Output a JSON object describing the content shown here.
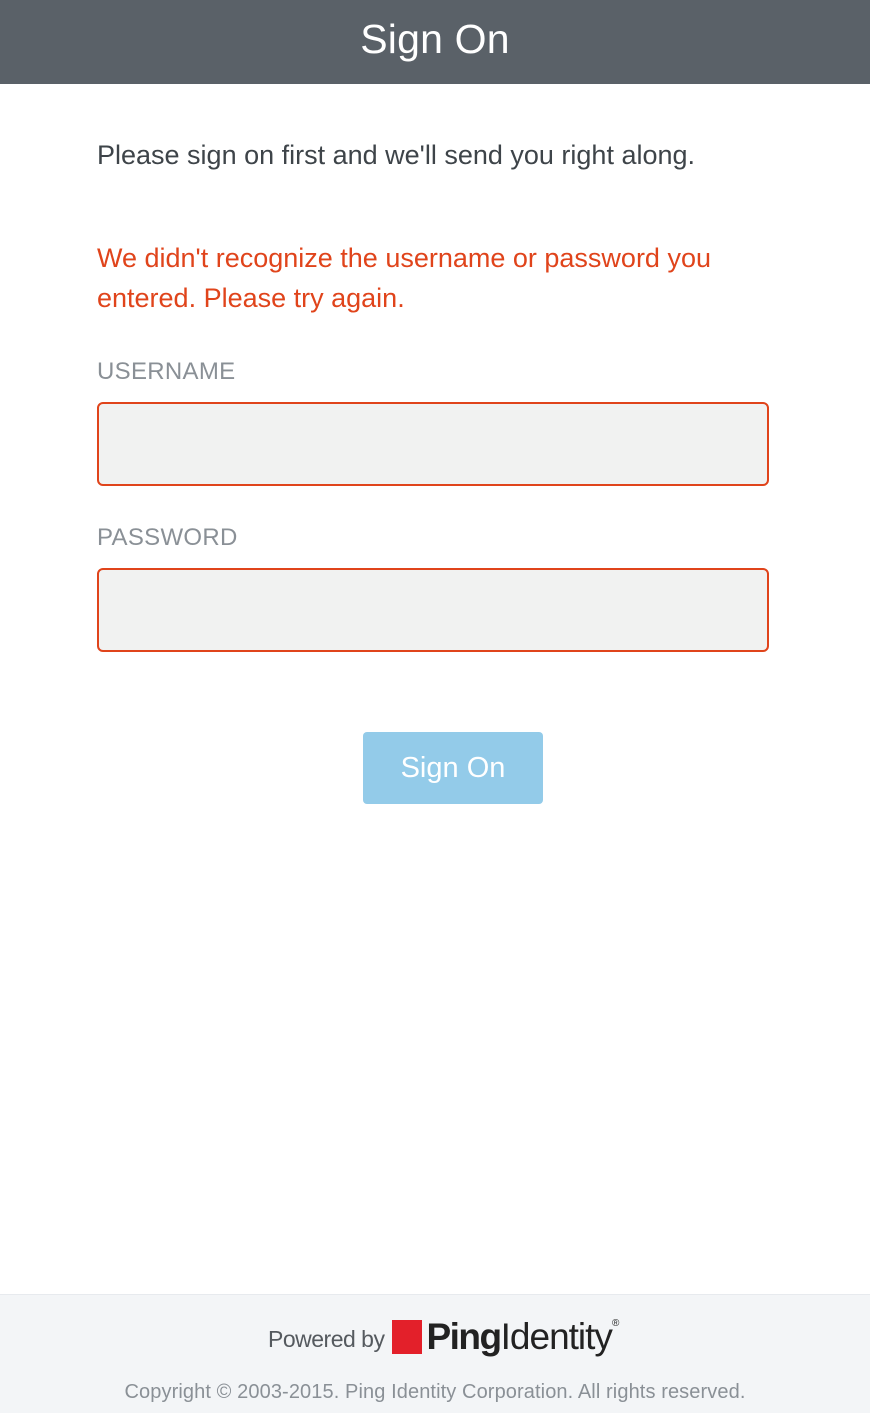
{
  "header": {
    "title": "Sign On"
  },
  "intro_text": "Please sign on first and we'll send you right along.",
  "error_message": "We didn't recognize the username or password you entered. Please try again.",
  "form": {
    "username_label": "USERNAME",
    "username_value": "",
    "password_label": "PASSWORD",
    "password_value": "",
    "submit_label": "Sign On"
  },
  "footer": {
    "powered_by": "Powered by",
    "logo_ping": "Ping",
    "logo_identity": "Identity",
    "logo_reg": "®",
    "copyright": "Copyright © 2003-2015. Ping Identity Corporation. All rights reserved."
  },
  "colors": {
    "header_bg": "#5a6168",
    "error": "#e0441b",
    "button_bg": "#93cbe9",
    "brand_red": "#e3202a"
  }
}
